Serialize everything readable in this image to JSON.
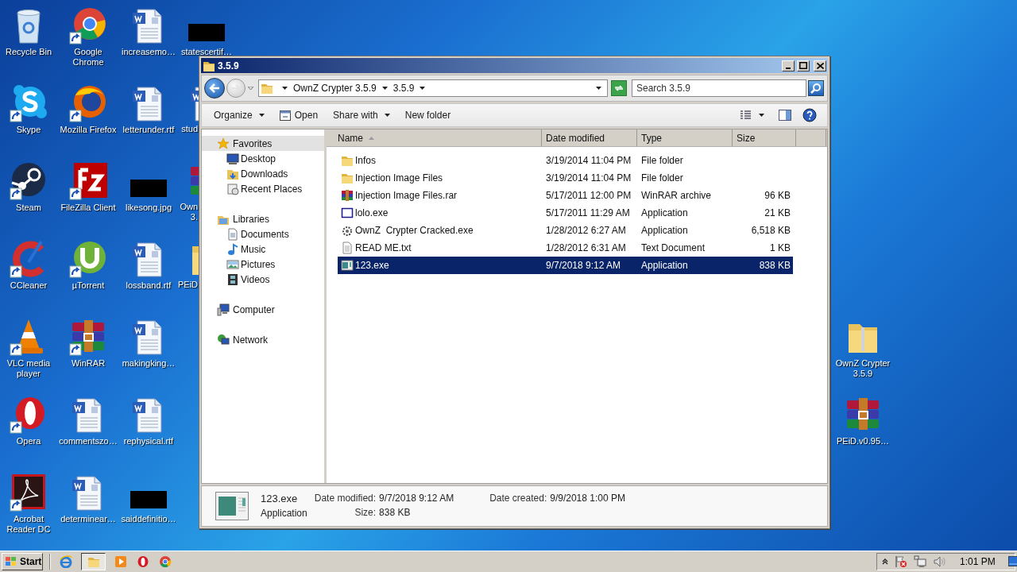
{
  "desktop": {
    "columns": [
      [
        {
          "lines": [
            "Recycle Bin"
          ],
          "kind": "recycle",
          "shortcut": false
        },
        {
          "lines": [
            "Skype"
          ],
          "kind": "skype",
          "shortcut": true
        },
        {
          "lines": [
            "Steam"
          ],
          "kind": "steam",
          "shortcut": true
        },
        {
          "lines": [
            "CCleaner"
          ],
          "kind": "ccleaner",
          "shortcut": true
        },
        {
          "lines": [
            "VLC media",
            "player"
          ],
          "kind": "vlc",
          "shortcut": true
        },
        {
          "lines": [
            "Opera"
          ],
          "kind": "opera",
          "shortcut": true
        },
        {
          "lines": [
            "Acrobat",
            "Reader DC"
          ],
          "kind": "acrobat",
          "shortcut": true
        }
      ],
      [
        {
          "lines": [
            "Google",
            "Chrome"
          ],
          "kind": "chrome",
          "shortcut": true
        },
        {
          "lines": [
            "Mozilla Firefox"
          ],
          "kind": "firefox",
          "shortcut": true
        },
        {
          "lines": [
            "FileZilla Client"
          ],
          "kind": "filezilla",
          "shortcut": true
        },
        {
          "lines": [
            "µTorrent"
          ],
          "kind": "utorrent",
          "shortcut": true
        },
        {
          "lines": [
            "WinRAR"
          ],
          "kind": "winrar",
          "shortcut": true
        },
        {
          "lines": [
            "commentszo…"
          ],
          "kind": "word",
          "shortcut": false
        },
        {
          "lines": [
            "determinear…"
          ],
          "kind": "word",
          "shortcut": false
        }
      ],
      [
        {
          "lines": [
            "increasemo…"
          ],
          "kind": "word",
          "shortcut": false
        },
        {
          "lines": [
            "letterunder.rtf"
          ],
          "kind": "word",
          "shortcut": false
        },
        {
          "lines": [
            "likesong.jpg"
          ],
          "kind": "image",
          "shortcut": false
        },
        {
          "lines": [
            "lossband.rtf"
          ],
          "kind": "word",
          "shortcut": false
        },
        {
          "lines": [
            "makingking…"
          ],
          "kind": "word",
          "shortcut": false
        },
        {
          "lines": [
            "rephysical.rtf"
          ],
          "kind": "word",
          "shortcut": false
        },
        {
          "lines": [
            "saiddefinitio…"
          ],
          "kind": "image",
          "shortcut": false
        }
      ],
      [
        {
          "lines": [
            "statescertif…"
          ],
          "kind": "image",
          "shortcut": false,
          "partially_hidden": false
        },
        {
          "lines": [
            "stud"
          ],
          "kind": "word",
          "shortcut": false,
          "partially_hidden": true
        },
        {
          "lines": [
            "Own",
            "3."
          ],
          "kind": "winrar",
          "shortcut": false,
          "partially_hidden": true
        },
        {
          "lines": [
            "PEiD"
          ],
          "kind": "folder",
          "shortcut": false,
          "partially_hidden": true
        }
      ]
    ],
    "right_column": [
      {
        "lines": [
          "OwnZ Crypter",
          "3.5.9"
        ],
        "kind": "folder",
        "shortcut": false
      },
      {
        "lines": [
          "PEiD.v0.95…"
        ],
        "kind": "winrar",
        "shortcut": false
      }
    ]
  },
  "window": {
    "title": "3.5.9",
    "address": {
      "crumbs": [
        "OwnZ Crypter 3.5.9",
        "3.5.9"
      ]
    },
    "search": {
      "placeholder": "Search 3.5.9"
    },
    "toolbar": [
      {
        "label": "Organize",
        "kind": "menu"
      },
      {
        "label": "Open",
        "kind": "open"
      },
      {
        "label": "Share with",
        "kind": "menu"
      },
      {
        "label": "New folder",
        "kind": "button"
      }
    ],
    "nav_pane": {
      "groups": [
        {
          "label": "Favorites",
          "kind": "star",
          "selected": true,
          "children": [
            {
              "label": "Desktop",
              "kind": "desktop",
              "selected": false
            },
            {
              "label": "Downloads",
              "kind": "downloads",
              "selected": false
            },
            {
              "label": "Recent Places",
              "kind": "recent",
              "selected": false
            }
          ]
        },
        {
          "label": "Libraries",
          "kind": "libraries",
          "selected": false,
          "children": [
            {
              "label": "Documents",
              "kind": "documents",
              "selected": false
            },
            {
              "label": "Music",
              "kind": "music",
              "selected": false
            },
            {
              "label": "Pictures",
              "kind": "pictures",
              "selected": false
            },
            {
              "label": "Videos",
              "kind": "videos",
              "selected": false
            }
          ]
        },
        {
          "label": "Computer",
          "kind": "computer",
          "selected": false
        },
        {
          "label": "Network",
          "kind": "network",
          "selected": false
        }
      ]
    },
    "table": {
      "columns": [
        {
          "label": "Name",
          "sorted": true
        },
        {
          "label": "Date modified",
          "sorted": false
        },
        {
          "label": "Type",
          "sorted": false
        },
        {
          "label": "Size",
          "sorted": false
        }
      ],
      "rows": [
        {
          "name": "Infos",
          "date": "3/19/2014 11:04 PM",
          "type": "File folder",
          "kind": "folder",
          "selected": false
        },
        {
          "name": "Injection Image Files",
          "date": "3/19/2014 11:04 PM",
          "type": "File folder",
          "kind": "folder",
          "selected": false
        },
        {
          "name": "Injection Image Files.rar",
          "date": "5/17/2011 12:00 PM",
          "type": "WinRAR archive",
          "size": "96 KB",
          "kind": "rar",
          "selected": false
        },
        {
          "name": "lolo.exe",
          "date": "5/17/2011 11:29 AM",
          "type": "Application",
          "size": "21 KB",
          "kind": "window",
          "selected": false
        },
        {
          "name": "OwnZ  Crypter Cracked.exe",
          "date": "1/28/2012 6:27 AM",
          "type": "Application",
          "size": "6,518 KB",
          "kind": "gear",
          "selected": false
        },
        {
          "name": "READ ME.txt",
          "date": "1/28/2012 6:31 AM",
          "type": "Text Document",
          "size": "1 KB",
          "kind": "text",
          "selected": false
        },
        {
          "name": "123.exe",
          "date": "9/7/2018 9:12 AM",
          "type": "Application",
          "size": "838 KB",
          "kind": "app",
          "selected": true
        }
      ]
    },
    "details": {
      "name": "123.exe",
      "type": "Application",
      "groups": [
        [
          {
            "label": "Date modified:",
            "value": "9/7/2018 9:12 AM"
          },
          {
            "label": "Size:",
            "value": "838 KB"
          }
        ],
        [
          {
            "label": "Date created:",
            "value": "9/9/2018 1:00 PM"
          }
        ]
      ]
    }
  },
  "taskbar": {
    "start": "Start",
    "quick_launch": [
      {
        "kind": "ie",
        "active": false
      },
      {
        "kind": "explorer",
        "active": true
      },
      {
        "kind": "media",
        "active": false
      },
      {
        "kind": "opera",
        "active": false
      },
      {
        "kind": "chrome",
        "active": false
      }
    ],
    "clock": "1:01 PM"
  }
}
